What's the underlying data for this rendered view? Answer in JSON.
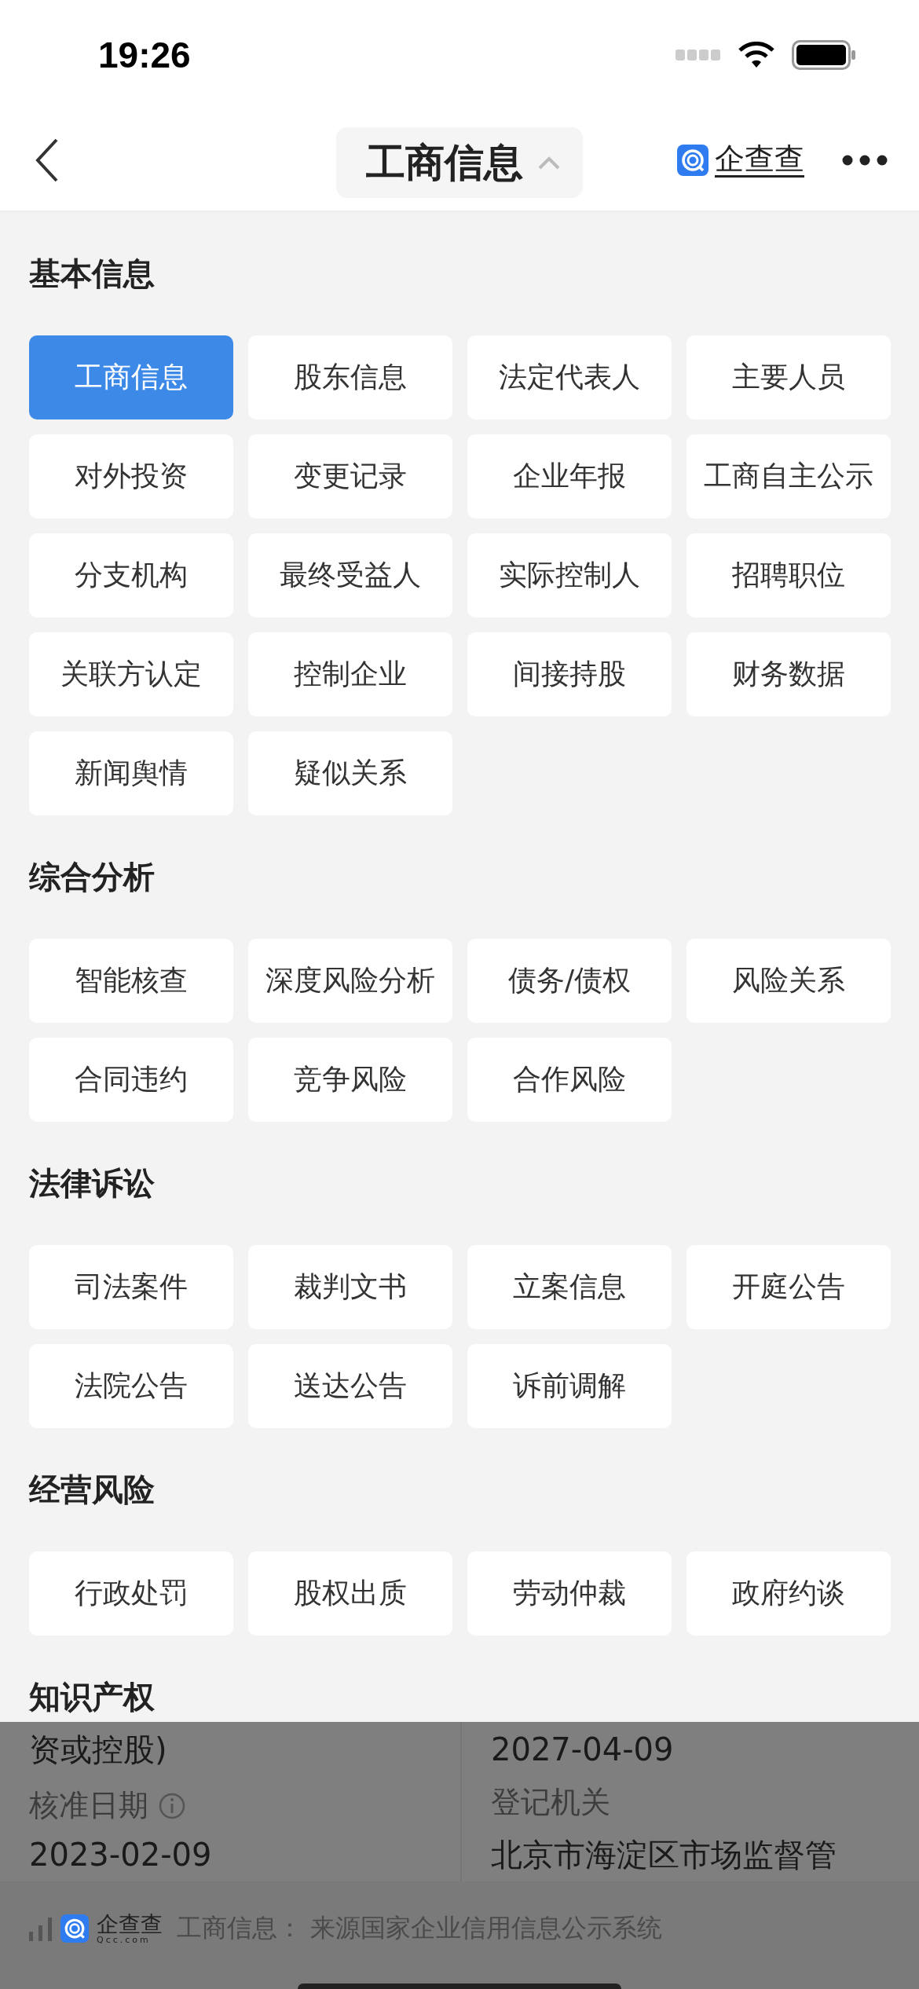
{
  "status_bar": {
    "time": "19:26"
  },
  "nav": {
    "title": "工商信息",
    "brand": "企查查"
  },
  "sections": [
    {
      "title": "基本信息",
      "items": [
        {
          "label": "工商信息",
          "selected": true
        },
        {
          "label": "股东信息",
          "selected": false
        },
        {
          "label": "法定代表人",
          "selected": false
        },
        {
          "label": "主要人员",
          "selected": false
        },
        {
          "label": "对外投资",
          "selected": false
        },
        {
          "label": "变更记录",
          "selected": false
        },
        {
          "label": "企业年报",
          "selected": false
        },
        {
          "label": "工商自主公示",
          "selected": false
        },
        {
          "label": "分支机构",
          "selected": false
        },
        {
          "label": "最终受益人",
          "selected": false
        },
        {
          "label": "实际控制人",
          "selected": false
        },
        {
          "label": "招聘职位",
          "selected": false
        },
        {
          "label": "关联方认定",
          "selected": false
        },
        {
          "label": "控制企业",
          "selected": false
        },
        {
          "label": "间接持股",
          "selected": false
        },
        {
          "label": "财务数据",
          "selected": false
        },
        {
          "label": "新闻舆情",
          "selected": false
        },
        {
          "label": "疑似关系",
          "selected": false
        }
      ]
    },
    {
      "title": "综合分析",
      "items": [
        {
          "label": "智能核查",
          "selected": false
        },
        {
          "label": "深度风险分析",
          "selected": false
        },
        {
          "label": "债务/债权",
          "selected": false
        },
        {
          "label": "风险关系",
          "selected": false
        },
        {
          "label": "合同违约",
          "selected": false
        },
        {
          "label": "竞争风险",
          "selected": false
        },
        {
          "label": "合作风险",
          "selected": false
        }
      ]
    },
    {
      "title": "法律诉讼",
      "items": [
        {
          "label": "司法案件",
          "selected": false
        },
        {
          "label": "裁判文书",
          "selected": false
        },
        {
          "label": "立案信息",
          "selected": false
        },
        {
          "label": "开庭公告",
          "selected": false
        },
        {
          "label": "法院公告",
          "selected": false
        },
        {
          "label": "送达公告",
          "selected": false
        },
        {
          "label": "诉前调解",
          "selected": false
        }
      ]
    },
    {
      "title": "经营风险",
      "items": [
        {
          "label": "行政处罚",
          "selected": false
        },
        {
          "label": "股权出质",
          "selected": false
        },
        {
          "label": "劳动仲裁",
          "selected": false
        },
        {
          "label": "政府约谈",
          "selected": false
        }
      ]
    },
    {
      "title": "知识产权"
    }
  ],
  "background_page": {
    "rows": [
      {
        "cells": [
          {
            "value": "资或控股)"
          },
          {
            "value": "2027-04-09"
          }
        ]
      },
      {
        "cells": [
          {
            "label": "核准日期",
            "info": true,
            "value": "2023-02-09"
          },
          {
            "label": "登记机关",
            "value": "北京市海淀区市场监督管"
          }
        ]
      }
    ]
  },
  "footer": {
    "brand": "企查查",
    "brand_domain": "Qcc.com",
    "source": "工商信息： 来源国家企业信用信息公示系统"
  }
}
